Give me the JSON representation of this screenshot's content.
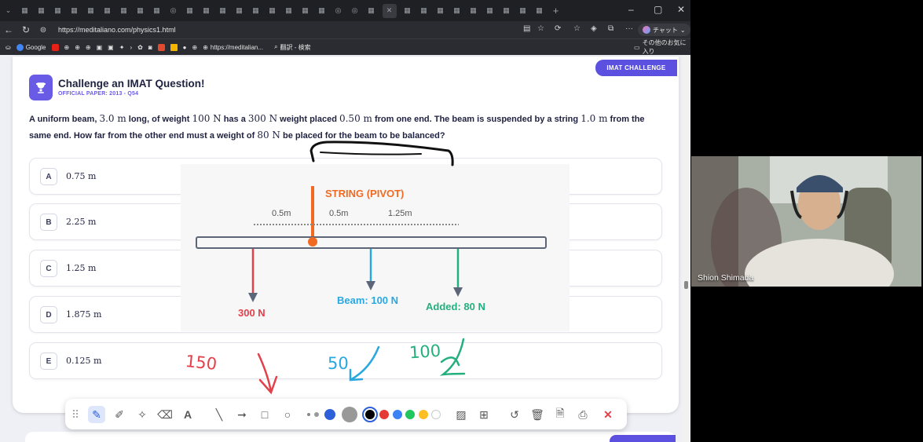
{
  "browser": {
    "url": "https://meditaliano.com/physics1.html",
    "chat_label": "チャット",
    "bookmarks": [
      {
        "label": "Google",
        "color": "#4285f4"
      },
      {
        "label": "https://meditalian...",
        "color": "#888888"
      },
      {
        "label": "翻訳 - 検索",
        "color": "#5b6bd6"
      }
    ],
    "other_bookmarks": "その他のお気に入り"
  },
  "card": {
    "tag": "IMAT CHALLENGE",
    "title": "Challenge an IMAT Question!",
    "subtitle": "OFFICIAL PAPER: 2013 - Q54",
    "question_parts": [
      "A uniform beam, ",
      "3.0 m",
      " long, of weight ",
      "100 N",
      " has a ",
      "300 N",
      " weight placed ",
      "0.50 m",
      " from one end. The beam is suspended by a string ",
      "1.0 m",
      " from the same end. How far from the other end must a weight of ",
      "80 N",
      " be placed for the beam to be balanced?"
    ],
    "options": [
      {
        "letter": "A",
        "value": "0.75 m"
      },
      {
        "letter": "B",
        "value": "2.25 m"
      },
      {
        "letter": "C",
        "value": "1.25 m"
      },
      {
        "letter": "D",
        "value": "1.875 m"
      },
      {
        "letter": "E",
        "value": "0.125 m"
      }
    ]
  },
  "diagram": {
    "string_label": "STRING (PIVOT)",
    "dist1": "0.5m",
    "dist2": "0.5m",
    "dist3": "1.25m",
    "force1": "300 N",
    "force2": "Beam: 100 N",
    "force3": "Added: 80 N",
    "colors": {
      "string": "#f26a21",
      "force1": "#e2404a",
      "force2": "#29a8e0",
      "force3": "#24b07e"
    }
  },
  "annotations": {
    "hw1": "150",
    "hw2": "50",
    "hw3": "100"
  },
  "toolbar": {
    "colors": [
      "#000000",
      "#e53935",
      "#3b82f6",
      "#22c55e",
      "#fbbf24",
      "#ffffff"
    ]
  },
  "video": {
    "participant_name": "Shion Shimada"
  }
}
